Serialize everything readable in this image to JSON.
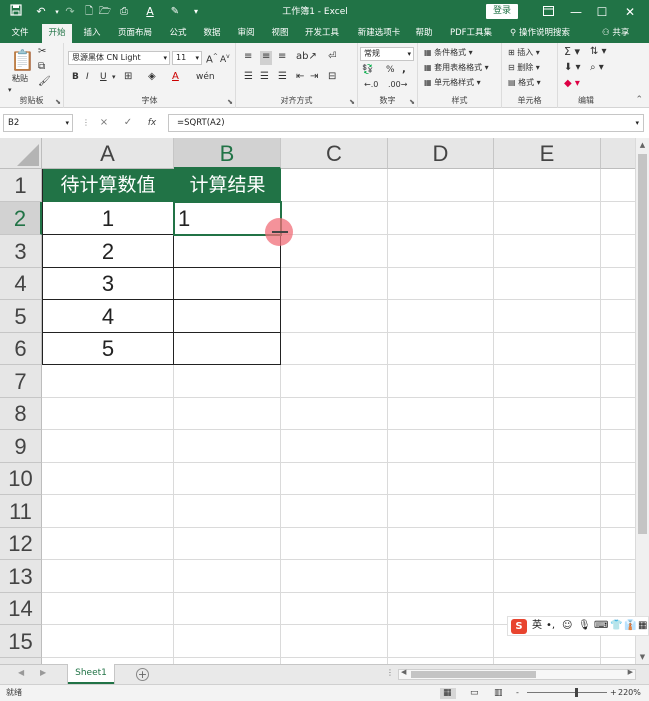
{
  "window": {
    "title": "工作簿1  -  Excel",
    "login_label": "登录",
    "minimize_icon": "minimize-icon",
    "restore_icon": "restore-icon",
    "close_icon": "close-icon"
  },
  "quick_access": {
    "save": "save-icon",
    "undo": "undo-icon",
    "redo": "redo-icon"
  },
  "tabs": [
    "文件",
    "开始",
    "插入",
    "页面布局",
    "公式",
    "数据",
    "审阅",
    "视图",
    "开发工具",
    "新建选项卡",
    "帮助",
    "PDF工具集"
  ],
  "active_tab": "开始",
  "tell_me": "操作说明搜索",
  "share": "共享",
  "ribbon": {
    "clipboard": {
      "paste": "粘贴",
      "label": "剪贴板"
    },
    "font": {
      "name": "思源黑体 CN Light",
      "size": "11",
      "bold": "B",
      "italic": "I",
      "underline": "U",
      "label": "字体"
    },
    "alignment": {
      "label": "对齐方式"
    },
    "number": {
      "format": "常规",
      "percent": "%",
      "comma": ",",
      "label": "数字"
    },
    "styles": {
      "conditional": "条件格式",
      "table": "套用表格格式",
      "cell_styles": "单元格样式",
      "label": "样式"
    },
    "cells": {
      "insert": "插入",
      "delete": "删除",
      "format": "格式",
      "label": "单元格"
    },
    "editing": {
      "label": "编辑"
    }
  },
  "formula_bar": {
    "name_box": "B2",
    "cancel": "×",
    "enter": "✓",
    "fx": "fx",
    "formula": "=SQRT(A2)"
  },
  "columns": [
    "A",
    "B",
    "C",
    "D",
    "E"
  ],
  "selected_column": "B",
  "rows": [
    "1",
    "2",
    "3",
    "4",
    "5",
    "6",
    "7",
    "8",
    "9",
    "10",
    "11",
    "12",
    "13",
    "14",
    "15"
  ],
  "selected_row": "2",
  "table": {
    "headers": [
      "待计算数值",
      "计算结果"
    ],
    "values": [
      "1",
      "2",
      "3",
      "4",
      "5"
    ],
    "results": [
      "1",
      "",
      "",
      "",
      ""
    ]
  },
  "sheet": {
    "tab": "Sheet1",
    "add": "+"
  },
  "status": {
    "ready": "就绪",
    "zoom": "220%",
    "zoom_minus": "-",
    "zoom_plus": "+"
  },
  "ime": {
    "logo": "S",
    "lang": "英"
  }
}
